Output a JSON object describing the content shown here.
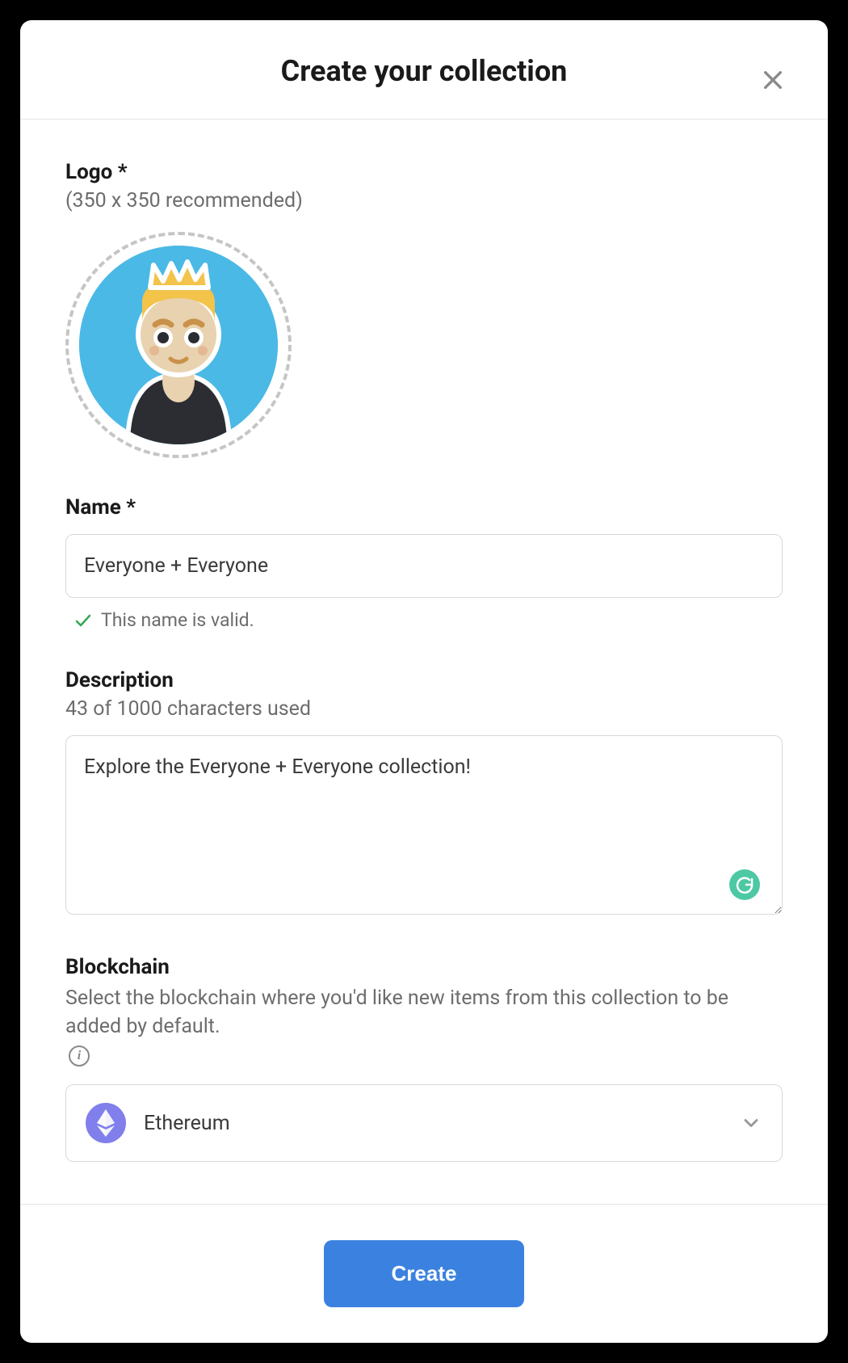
{
  "modal": {
    "title": "Create your collection"
  },
  "logo": {
    "label": "Logo *",
    "hint": "(350 x 350 recommended)"
  },
  "name": {
    "label": "Name *",
    "value": "Everyone + Everyone",
    "valid_message": "This name is valid."
  },
  "description": {
    "label": "Description",
    "counter": "43 of 1000 characters used",
    "value": "Explore the Everyone + Everyone collection!"
  },
  "blockchain": {
    "label": "Blockchain",
    "hint": "Select the blockchain where you'd like new items from this collection to be added by default.",
    "selected": "Ethereum"
  },
  "actions": {
    "create": "Create"
  }
}
